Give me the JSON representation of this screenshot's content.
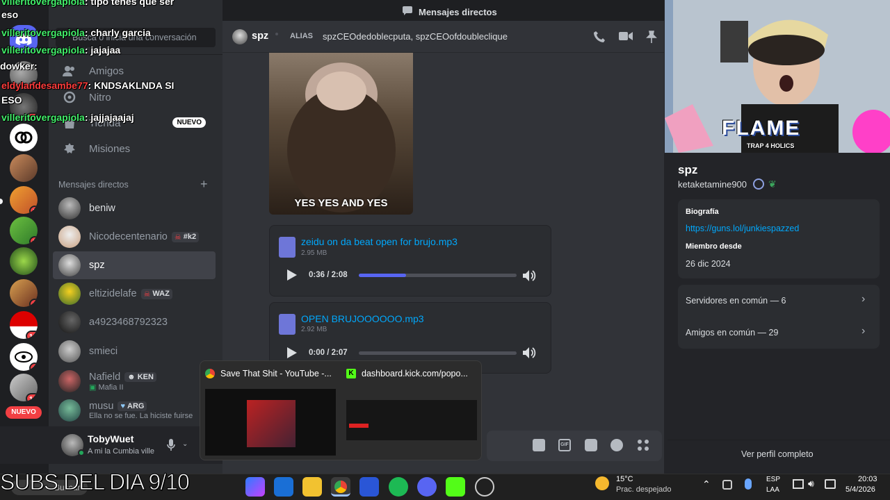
{
  "top": {
    "title": "Mensajes directos"
  },
  "rail": {
    "badges": [
      "2",
      "13",
      "5",
      "5",
      "1",
      "16",
      "6",
      "14"
    ],
    "new_label": "NUEVO"
  },
  "sidebar": {
    "search_placeholder": "Busca o inicia una conversación",
    "nav": [
      {
        "label": "Amigos"
      },
      {
        "label": "Nitro"
      },
      {
        "label": "Tienda",
        "badge": "NUEVO"
      },
      {
        "label": "Misiones"
      }
    ],
    "dm_header": "Mensajes directos",
    "dms": [
      {
        "name": "beniw"
      },
      {
        "name": "Nicodecentenario",
        "tag": "#k2"
      },
      {
        "name": "spz"
      },
      {
        "name": "eltizidelafe",
        "tag": "WAZ"
      },
      {
        "name": "a4923468792323"
      },
      {
        "name": "smieci"
      },
      {
        "name": "Nafield",
        "tag": "KEN",
        "sub": "Mafia II"
      },
      {
        "name": "musu",
        "tag": "ARG",
        "sub": "Ella no se fue. La hiciste fuirse"
      }
    ],
    "user": {
      "name": "TobyWuet",
      "status": "A mi la Cumbia ville"
    }
  },
  "chat": {
    "header_name": "spz",
    "alias_label": "ALIAS",
    "aliases": "spzCEOdedoblecputa, spzCEOofdoubleclique",
    "gif_caption": "YES YES AND YES",
    "attachments": [
      {
        "name": "zeidu on da beat open for brujo.mp3",
        "size": "2.95 MB",
        "time": "0:36 / 2:08",
        "progress": 0.3
      },
      {
        "name": "OPEN BRUJOOOOOO.mp3",
        "size": "2.92 MB",
        "time": "0:00 / 2:07",
        "progress": 0.0
      }
    ]
  },
  "profile": {
    "name": "spz",
    "username": "ketaketamine900",
    "bio_label": "Biografía",
    "bio_link": "https://guns.lol/junkiespazzed",
    "member_label": "Miembro desde",
    "member_date": "26 dic 2024",
    "servers_common": "Servidores en común — 6",
    "friends_common": "Amigos en común — 29",
    "view_full": "Ver perfil completo",
    "webcam_sign": "FLAME",
    "webcam_sub": "TRAP 4 HOLICS"
  },
  "overlay_chat": [
    {
      "user": "villeritovergapiola",
      "msg": "tipo tenes que ser"
    },
    {
      "user": "",
      "msg": "eso"
    },
    {
      "user": "villeritovergapiola",
      "msg": "charly garcia"
    },
    {
      "user": "villeritovergapiola",
      "msg": "jajajaa"
    },
    {
      "user": "dowker",
      "msg": ""
    },
    {
      "user": "eldylandesambe77",
      "msg": "KNDSAKLNDA SI"
    },
    {
      "user": "",
      "msg": "ESO"
    },
    {
      "user": "villeritovergapiola",
      "msg": "jajjajaajaj"
    }
  ],
  "stream_banner": "SUBS DEL DIA 9/10",
  "taskbar_preview": {
    "items": [
      {
        "title": "Save That Shit - YouTube -..."
      },
      {
        "title": "dashboard.kick.com/popo..."
      }
    ]
  },
  "taskbar": {
    "search": "Buscar",
    "weather_temp": "15°C",
    "weather_desc": "Prac. despejado",
    "lang1": "ESP",
    "lang2": "LAA",
    "time": "20:03",
    "date": "5/4/2026"
  },
  "colors": {
    "accent": "#5865f2",
    "link": "#00a8fc",
    "danger": "#f23f43",
    "green": "#43f06b"
  }
}
